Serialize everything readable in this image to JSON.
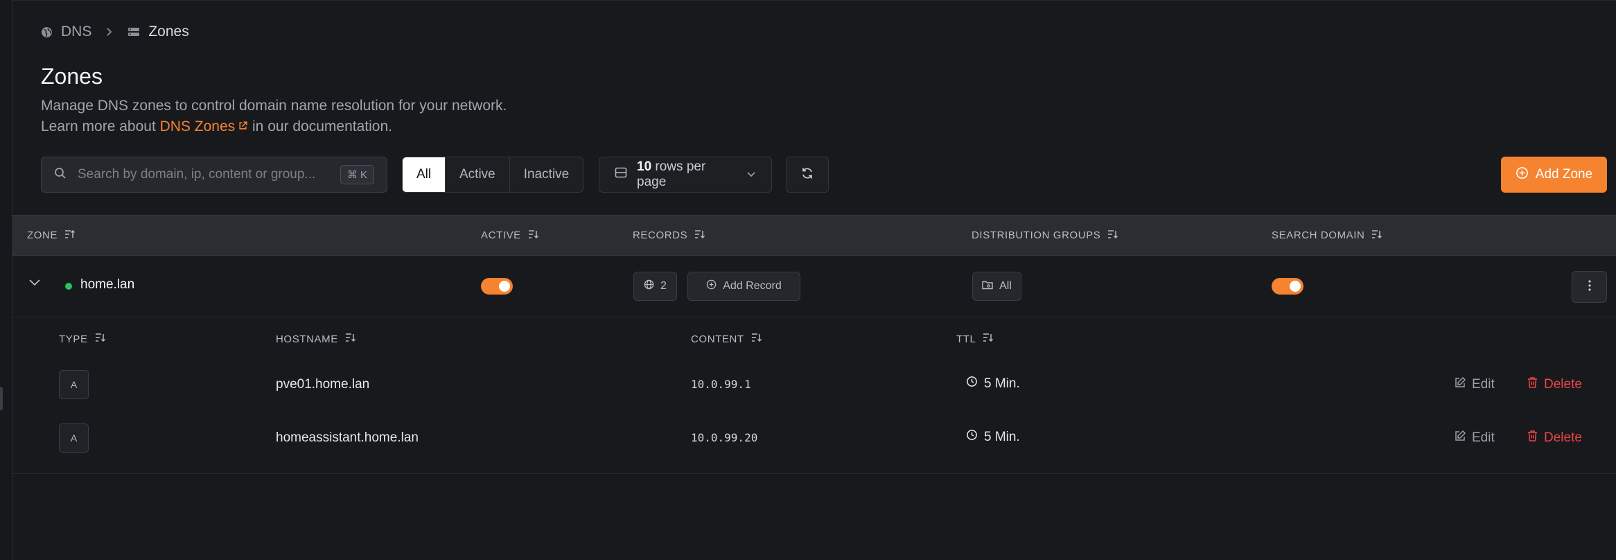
{
  "breadcrumb": {
    "root": "DNS",
    "current": "Zones"
  },
  "page": {
    "title": "Zones",
    "desc_line1": "Manage DNS zones to control domain name resolution for your network.",
    "desc_prefix": "Learn more about",
    "desc_link": "DNS Zones",
    "desc_suffix": "in our documentation."
  },
  "toolbar": {
    "search_placeholder": "Search by domain, ip, content or group...",
    "search_shortcut": "⌘ K",
    "filters": [
      "All",
      "Active",
      "Inactive"
    ],
    "active_filter": "All",
    "rows_count": "10",
    "rows_label": "rows per page",
    "add_zone_label": "Add Zone"
  },
  "table": {
    "columns": {
      "zone": "Zone",
      "active": "Active",
      "records": "Records",
      "distribution_groups": "Distribution Groups",
      "search_domain": "Search Domain"
    },
    "zone": {
      "name": "home.lan",
      "records_count": "2",
      "add_record_label": "Add Record",
      "group_label": "All",
      "active": true,
      "search_domain": true
    },
    "sub_columns": {
      "type": "Type",
      "hostname": "Hostname",
      "content": "Content",
      "ttl": "TTL"
    },
    "records": [
      {
        "type": "A",
        "hostname": "pve01.home.lan",
        "content": "10.0.99.1",
        "ttl": "5 Min."
      },
      {
        "type": "A",
        "hostname": "homeassistant.home.lan",
        "content": "10.0.99.20",
        "ttl": "5 Min."
      }
    ],
    "edit_label": "Edit",
    "delete_label": "Delete"
  },
  "colors": {
    "accent": "#f68330",
    "danger": "#ef4444",
    "success": "#22c55e",
    "background": "#18191d"
  }
}
